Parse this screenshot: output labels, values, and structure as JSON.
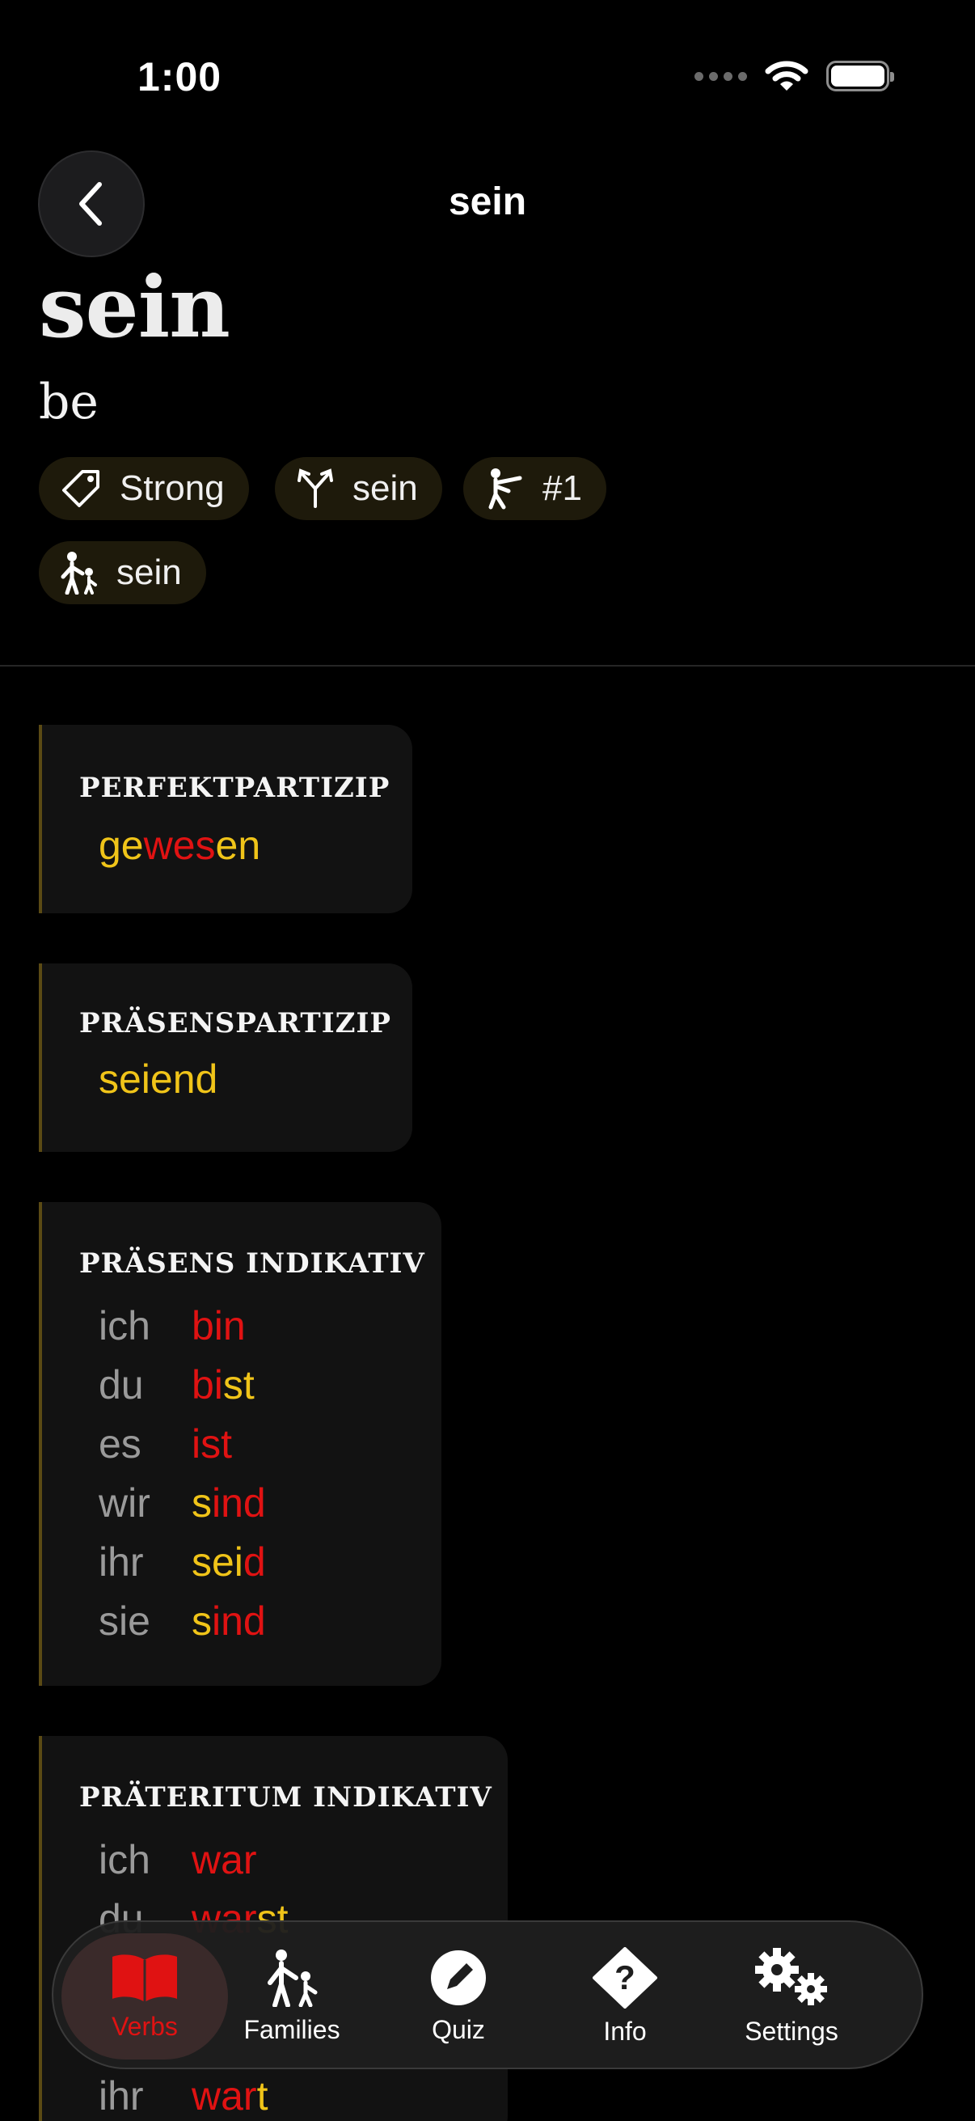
{
  "status": {
    "time": "1:00"
  },
  "nav": {
    "title": "sein"
  },
  "verb": {
    "infinitive": "sein",
    "meaning": "be"
  },
  "tags": [
    {
      "label": "Strong",
      "icon": "tag-icon"
    },
    {
      "label": "sein",
      "icon": "branch-icon"
    },
    {
      "label": "#1",
      "icon": "kick-figure-icon"
    },
    {
      "label": "sein",
      "icon": "family-icon"
    }
  ],
  "perfektpartizip": {
    "heading": "PERFEKTPARTIZIP",
    "parts": [
      "ge",
      "wes",
      "en"
    ]
  },
  "praesenspartizip": {
    "heading": "PRÄSENSPARTIZIP",
    "parts": [
      "seiend"
    ]
  },
  "praesens_indikativ": {
    "heading": "PRÄSENS INDIKATIV",
    "rows": [
      {
        "pronoun": "ich",
        "parts": [
          "bin"
        ]
      },
      {
        "pronoun": "du",
        "parts": [
          "bi",
          "st"
        ]
      },
      {
        "pronoun": "es",
        "parts": [
          "ist"
        ]
      },
      {
        "pronoun": "wir",
        "parts": [
          "s",
          "ind"
        ]
      },
      {
        "pronoun": "ihr",
        "parts": [
          "sei",
          "d"
        ]
      },
      {
        "pronoun": "sie",
        "parts": [
          "s",
          "ind"
        ]
      }
    ]
  },
  "praeteritum_indikativ": {
    "heading": "PRÄTERITUM INDIKATIV",
    "rows": [
      {
        "pronoun": "ich",
        "parts": [
          "war"
        ]
      },
      {
        "pronoun": "du",
        "parts": [
          "war",
          "st"
        ]
      },
      {
        "pronoun": "ihr",
        "parts": [
          "war",
          "t"
        ]
      }
    ]
  },
  "tabbar": {
    "items": [
      {
        "label": "Verbs",
        "icon": "book-icon"
      },
      {
        "label": "Families",
        "icon": "family-icon"
      },
      {
        "label": "Quiz",
        "icon": "pencil-icon"
      },
      {
        "label": "Info",
        "icon": "question-icon"
      },
      {
        "label": "Settings",
        "icon": "gears-icon"
      }
    ]
  },
  "colors": {
    "yellow": "#f0c419",
    "red": "#e01212",
    "accent_bar": "#5b4a14"
  }
}
